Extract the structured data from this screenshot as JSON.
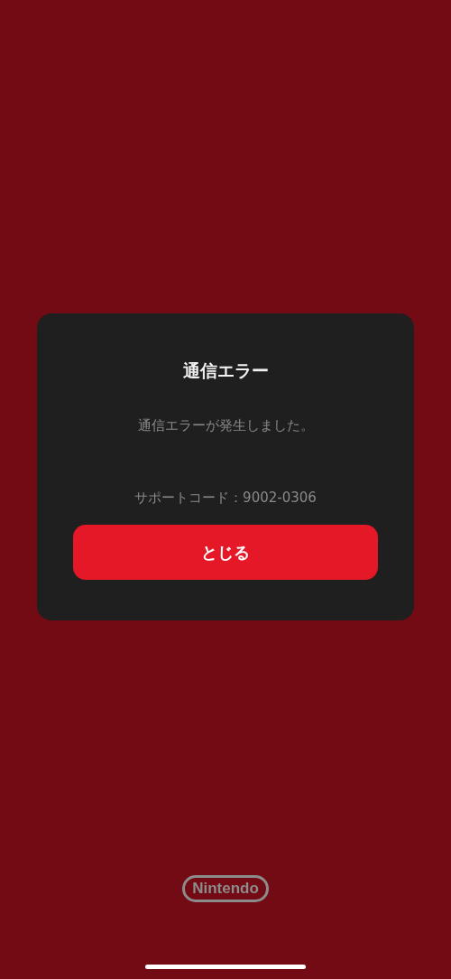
{
  "dialog": {
    "title": "通信エラー",
    "message": "通信エラーが発生しました。",
    "support_code": "サポートコード：9002-0306",
    "button": "とじる"
  },
  "footer": {
    "logo": "Nintendo"
  }
}
